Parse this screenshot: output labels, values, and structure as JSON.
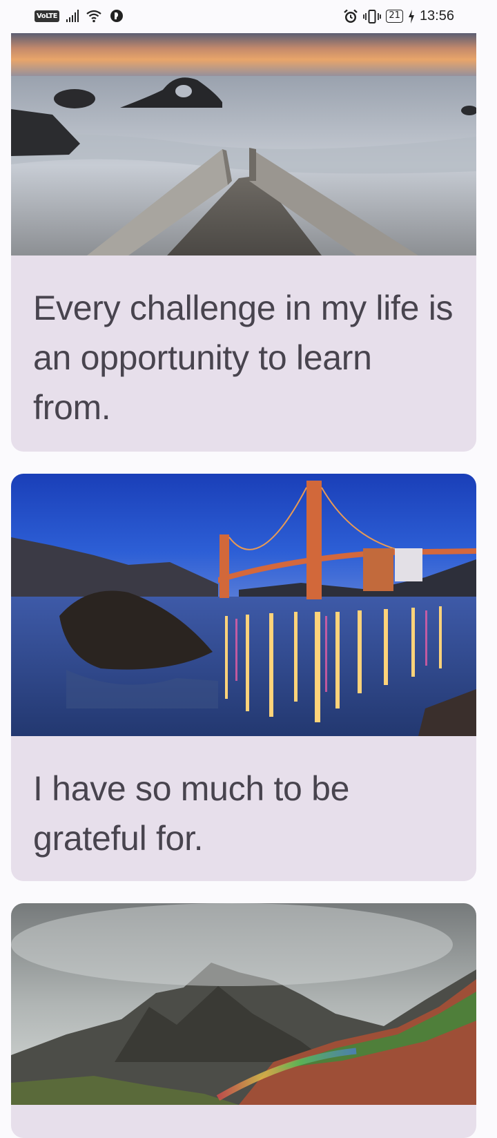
{
  "status_bar": {
    "network_badge": "VoLTE",
    "battery_level": "21",
    "time": "13:56",
    "icons": [
      "signal-bars-icon",
      "wifi-icon",
      "app-notification-icon",
      "alarm-icon",
      "vibrate-icon",
      "battery-icon",
      "charging-icon"
    ]
  },
  "feed": {
    "cards": [
      {
        "image": "ocean-pier-sunset",
        "quote": "Every challenge in my life is an opportunity to learn from."
      },
      {
        "image": "golden-gate-bridge-night",
        "quote": "I have so much to be grateful for."
      },
      {
        "image": "mountains-rainbow-clouds",
        "quote": ""
      }
    ]
  },
  "colors": {
    "card_background": "#e7dfeb",
    "quote_text": "#48444e",
    "page_background": "#fbfafd"
  }
}
